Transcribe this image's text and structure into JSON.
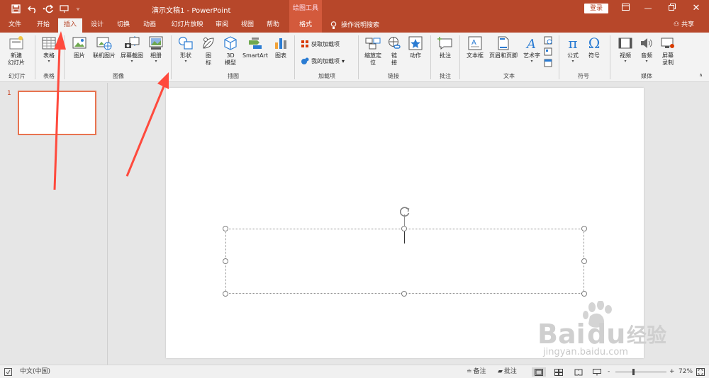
{
  "titlebar": {
    "doc_title": "演示文稿1  -  PowerPoint",
    "drawing_tools": "绘图工具",
    "login": "登录",
    "bg_color": "#b7472a",
    "qat_icons": [
      "save-icon",
      "undo-icon",
      "redo-icon",
      "start-from-beginning-icon",
      "customize-qat-icon"
    ],
    "window_controls": [
      "ribbon-display-options-icon",
      "minimize-icon",
      "restore-icon",
      "close-icon"
    ]
  },
  "tabs": [
    {
      "label": "文件"
    },
    {
      "label": "开始"
    },
    {
      "label": "插入",
      "active": true
    },
    {
      "label": "设计"
    },
    {
      "label": "切换"
    },
    {
      "label": "动画"
    },
    {
      "label": "幻灯片放映"
    },
    {
      "label": "审阅"
    },
    {
      "label": "视图"
    },
    {
      "label": "帮助"
    },
    {
      "label": "格式"
    }
  ],
  "tell_me": "操作说明搜索",
  "share": "共享",
  "ribbon": {
    "slides": {
      "new_slide_1": "新建",
      "new_slide_2": "幻灯片",
      "group": "幻灯片"
    },
    "tables": {
      "table": "表格",
      "group": "表格"
    },
    "images": {
      "picture": "图片",
      "online_picture": "联机图片",
      "screenshot": "屏幕截图",
      "album": "相册",
      "group": "图像"
    },
    "illustrations": {
      "shapes": "形状",
      "icons_1": "图",
      "icons_2": "标",
      "model3d_1": "3D",
      "model3d_2": "模型",
      "smartart": "SmartArt",
      "chart": "图表",
      "group": "插图"
    },
    "addins": {
      "get": "获取加载项",
      "my": "我的加载项",
      "group": "加载项"
    },
    "links": {
      "zoom_1": "缩放定",
      "zoom_2": "位",
      "link_1": "链",
      "link_2": "接",
      "action": "动作",
      "group": "链接"
    },
    "comments": {
      "comment": "批注",
      "group": "批注"
    },
    "text": {
      "textbox": "文本框",
      "header_footer": "页眉和页脚",
      "wordart": "艺术字",
      "group": "文本"
    },
    "symbols": {
      "equation": "公式",
      "symbol": "符号",
      "group": "符号"
    },
    "media": {
      "video": "视频",
      "audio": "音频",
      "screen_rec_1": "屏幕",
      "screen_rec_2": "录制",
      "group": "媒体"
    }
  },
  "thumbnail": {
    "slide_number": "1"
  },
  "watermark": {
    "brand": "Bai",
    "brand_cn": "经验",
    "url": "jingyan.baidu.com"
  },
  "statusbar": {
    "language": "中文(中国)",
    "notes": "备注",
    "comments": "批注",
    "zoom": "72%",
    "zoom_minus": "-",
    "zoom_plus": "+"
  }
}
